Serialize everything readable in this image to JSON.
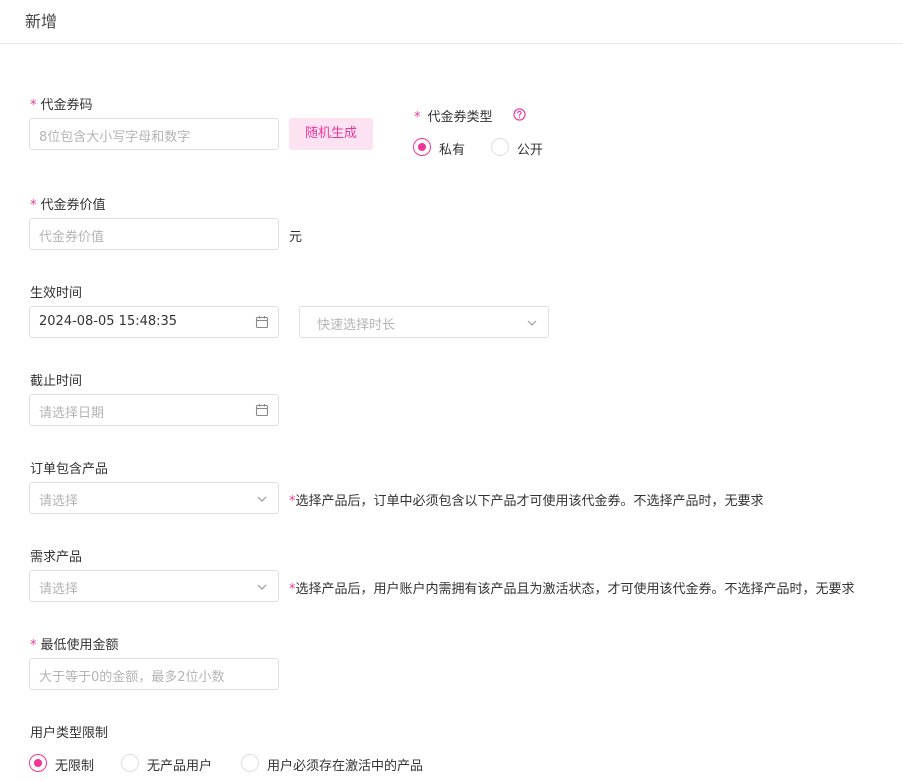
{
  "header": {
    "title": "新增"
  },
  "form": {
    "code": {
      "label": "代金券码",
      "placeholder": "8位包含大小写字母和数字",
      "button": "随机生成"
    },
    "type": {
      "label": "代金券类型",
      "options": [
        "私有",
        "公开"
      ],
      "selected": "私有"
    },
    "value": {
      "label": "代金券价值",
      "placeholder": "代金券价值",
      "unit": "元"
    },
    "start": {
      "label": "生效时间",
      "value": "2024-08-05 15:48:35",
      "quick_placeholder": "快速选择时长"
    },
    "end": {
      "label": "截止时间",
      "placeholder": "请选择日期"
    },
    "order_products": {
      "label": "订单包含产品",
      "placeholder": "请选择",
      "hint": "选择产品后，订单中必须包含以下产品才可使用该代金券。不选择产品时，无要求"
    },
    "required_products": {
      "label": "需求产品",
      "placeholder": "请选择",
      "hint": "选择产品后，用户账户内需拥有该产品且为激活状态，才可使用该代金券。不选择产品时，无要求"
    },
    "min_amount": {
      "label": "最低使用金额",
      "placeholder": "大于等于0的金额，最多2位小数"
    },
    "user_type": {
      "label": "用户类型限制",
      "options": [
        "无限制",
        "无产品用户",
        "用户必须存在激活中的产品"
      ],
      "selected": "无限制"
    }
  },
  "colors": {
    "accent": "#f0349b",
    "accent_bg": "#fde3f2",
    "border": "#dcdfe6",
    "placeholder": "#b4b4b4"
  },
  "icons": {
    "calendar": "calendar-icon",
    "chevron": "chevron-down-icon",
    "help": "help-circle-icon"
  }
}
